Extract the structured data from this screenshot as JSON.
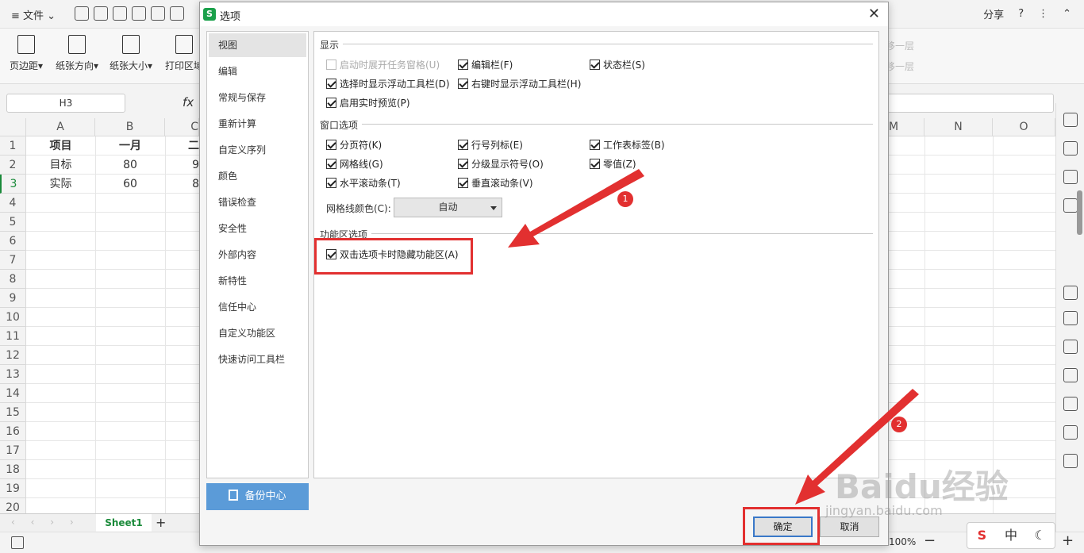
{
  "menubar": {
    "file_label": "文件",
    "share_label": "分享"
  },
  "ribbon": {
    "buttons": [
      "页边距",
      "纸张方向",
      "纸张大小",
      "打印区域"
    ],
    "right_dim": [
      "移一层",
      "移一层"
    ]
  },
  "formula": {
    "namebox": "H3",
    "fx": "fx"
  },
  "grid": {
    "columns": [
      "A",
      "B",
      "C",
      "M",
      "N",
      "O"
    ],
    "rows": [
      "1",
      "2",
      "3",
      "4",
      "5",
      "6",
      "7",
      "8",
      "9",
      "10",
      "11",
      "12",
      "13",
      "14",
      "15",
      "16",
      "17",
      "18",
      "19",
      "20"
    ],
    "cells": {
      "a1": "项目",
      "b1": "一月",
      "c1": "二",
      "a2": "目标",
      "b2": "80",
      "c2": "9",
      "a3": "实际",
      "b3": "60",
      "c3": "8"
    }
  },
  "sheets": {
    "active": "Sheet1",
    "add": "+"
  },
  "dialog": {
    "title": "选项",
    "close": "✕",
    "nav": [
      "视图",
      "编辑",
      "常规与保存",
      "重新计算",
      "自定义序列",
      "颜色",
      "错误检查",
      "安全性",
      "外部内容",
      "新特性",
      "信任中心",
      "自定义功能区",
      "快速访问工具栏"
    ],
    "backup_label": "备份中心",
    "sections": {
      "display": "显示",
      "window": "窗口选项",
      "ribbon": "功能区选项"
    },
    "display_options": [
      {
        "label": "启动时展开任务窗格(U)",
        "checked": false,
        "disabled": true
      },
      {
        "label": "编辑栏(F)",
        "checked": true
      },
      {
        "label": "状态栏(S)",
        "checked": true
      },
      {
        "label": "选择时显示浮动工具栏(D)",
        "checked": true
      },
      {
        "label": "右键时显示浮动工具栏(H)",
        "checked": true
      },
      {
        "label": "启用实时预览(P)",
        "checked": true
      }
    ],
    "window_options": [
      {
        "label": "分页符(K)",
        "checked": true
      },
      {
        "label": "行号列标(E)",
        "checked": true
      },
      {
        "label": "工作表标签(B)",
        "checked": true
      },
      {
        "label": "网格线(G)",
        "checked": true
      },
      {
        "label": "分级显示符号(O)",
        "checked": true
      },
      {
        "label": "零值(Z)",
        "checked": true
      },
      {
        "label": "水平滚动条(T)",
        "checked": true
      },
      {
        "label": "垂直滚动条(V)",
        "checked": true
      }
    ],
    "gridline_color_label": "网格线颜色(C):",
    "gridline_color_value": "自动",
    "ribbon_options": [
      {
        "label": "双击选项卡时隐藏功能区(A)",
        "checked": true
      }
    ],
    "ok_label": "确定",
    "cancel_label": "取消"
  },
  "annotations": {
    "badge1": "1",
    "badge2": "2",
    "color": "#e23030"
  },
  "watermark": {
    "text": "Baidu经验",
    "url": "jingyan.baidu.com"
  },
  "ime": {
    "brand": "S",
    "mode": "中",
    "moon": "☾"
  },
  "status": {
    "zoom": "100%"
  }
}
